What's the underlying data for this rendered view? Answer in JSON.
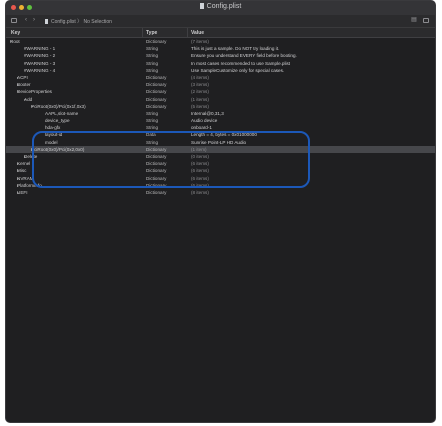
{
  "window": {
    "title": "Config.plist"
  },
  "toolbar": {
    "path_file": "Config.plist",
    "path_sep": "〉",
    "path_sel": "No Selection"
  },
  "header": {
    "key": "Key",
    "type": "Type",
    "value": "Value"
  },
  "rows": [
    {
      "indent": 0,
      "tri": "▾",
      "key": "Root",
      "type": "Dictionary",
      "value": "(7 items)",
      "dim": true
    },
    {
      "indent": 2,
      "tri": "",
      "key": "#WARNING - 1",
      "type": "String",
      "value": "This is just a sample. Do NOT try loading it."
    },
    {
      "indent": 2,
      "tri": "",
      "key": "#WARNING - 2",
      "type": "String",
      "value": "Ensure you understand EVERY field before booting."
    },
    {
      "indent": 2,
      "tri": "",
      "key": "#WARNING - 3",
      "type": "String",
      "value": "In most cases recommended to use Sample.plist"
    },
    {
      "indent": 2,
      "tri": "",
      "key": "#WARNING - 4",
      "type": "String",
      "value": "Use SampleCustomize only for special cases."
    },
    {
      "indent": 1,
      "tri": "▸",
      "key": "ACPI",
      "type": "Dictionary",
      "value": "(4 items)",
      "dim": true
    },
    {
      "indent": 1,
      "tri": "▸",
      "key": "Booter",
      "type": "Dictionary",
      "value": "(3 items)",
      "dim": true
    },
    {
      "indent": 1,
      "tri": "▾",
      "key": "DeviceProperties",
      "type": "Dictionary",
      "value": "(2 items)",
      "dim": true
    },
    {
      "indent": 2,
      "tri": "▾",
      "key": "Add",
      "type": "Dictionary",
      "value": "(1 items)",
      "dim": true
    },
    {
      "indent": 3,
      "tri": "▾",
      "key": "PciRoot(0x0)/Pci(0x1f,0x3)",
      "type": "Dictionary",
      "value": "(5 items)",
      "dim": true
    },
    {
      "indent": 5,
      "tri": "",
      "key": "AAPL,slot-name",
      "type": "String",
      "value": "Internal@0,31,3"
    },
    {
      "indent": 5,
      "tri": "",
      "key": "device_type",
      "type": "String",
      "value": "Audio device"
    },
    {
      "indent": 5,
      "tri": "",
      "key": "hda-gfx",
      "type": "String",
      "value": "onboard-1"
    },
    {
      "indent": 5,
      "tri": "",
      "key": "layout-id",
      "type": "Data",
      "value": "Length = 4, bytes = 0x01000000"
    },
    {
      "indent": 5,
      "tri": "",
      "key": "model",
      "type": "String",
      "value": "Sunrise Point-LP HD Audio"
    },
    {
      "indent": 3,
      "tri": "▸",
      "key": "PciRoot(0x0)/Pci(0x2,0x0)",
      "type": "Dictionary",
      "value": "(1 item)",
      "dim": true,
      "sel": true
    },
    {
      "indent": 2,
      "tri": "▸",
      "key": "Delete",
      "type": "Dictionary",
      "value": "(0 items)",
      "dim": true
    },
    {
      "indent": 1,
      "tri": "▸",
      "key": "Kernel",
      "type": "Dictionary",
      "value": "(6 items)",
      "dim": true
    },
    {
      "indent": 1,
      "tri": "▸",
      "key": "Misc",
      "type": "Dictionary",
      "value": "(6 items)",
      "dim": true
    },
    {
      "indent": 1,
      "tri": "▸",
      "key": "NVRAM",
      "type": "Dictionary",
      "value": "(6 items)",
      "dim": true
    },
    {
      "indent": 1,
      "tri": "▸",
      "key": "PlatformInfo",
      "type": "Dictionary",
      "value": "(6 items)",
      "dim": true
    },
    {
      "indent": 1,
      "tri": "▸",
      "key": "UEFI",
      "type": "Dictionary",
      "value": "(8 items)",
      "dim": true
    }
  ],
  "colors": {
    "window_bg": "#1f1f21",
    "highlight_border": "#1c58b8",
    "selected_row": "#46474b"
  },
  "icons": [
    "file-icon",
    "sidebar-toggle-icon",
    "back-arrow-icon",
    "forward-arrow-icon",
    "table-icon"
  ]
}
